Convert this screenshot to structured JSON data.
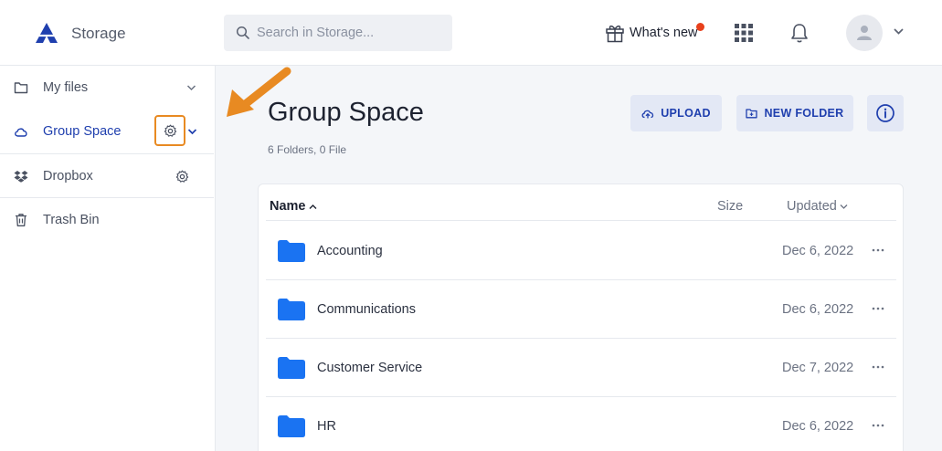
{
  "header": {
    "app_title": "Storage",
    "search_placeholder": "Search in Storage...",
    "whats_new_label": "What's new",
    "notification_dot_color": "#e8401c",
    "icons": [
      "logo-icon",
      "search-icon",
      "gift-icon",
      "apps-grid-icon",
      "bell-icon",
      "user-avatar-icon",
      "chevron-down-icon"
    ]
  },
  "sidebar": {
    "items": [
      {
        "label": "My files",
        "icon": "folder-outline-icon"
      },
      {
        "label": "Group Space",
        "icon": "cloud-icon",
        "active": true
      },
      {
        "label": "Dropbox",
        "icon": "dropbox-icon"
      },
      {
        "label": "Trash Bin",
        "icon": "trash-icon"
      }
    ]
  },
  "main": {
    "title": "Group Space",
    "subtitle": "6 Folders, 0 File",
    "buttons": {
      "upload": "UPLOAD",
      "new_folder": "NEW FOLDER"
    },
    "table": {
      "columns": {
        "name": "Name",
        "size": "Size",
        "updated": "Updated"
      },
      "rows": [
        {
          "name": "Accounting",
          "size": "",
          "updated": "Dec 6, 2022"
        },
        {
          "name": "Communications",
          "size": "",
          "updated": "Dec 6, 2022"
        },
        {
          "name": "Customer Service",
          "size": "",
          "updated": "Dec 7, 2022"
        },
        {
          "name": "HR",
          "size": "",
          "updated": "Dec 6, 2022"
        }
      ]
    }
  },
  "colors": {
    "accent": "#1f3fae",
    "folder": "#1a73f2",
    "annotation": "#e88a22",
    "button_bg": "#e3e8f5"
  }
}
